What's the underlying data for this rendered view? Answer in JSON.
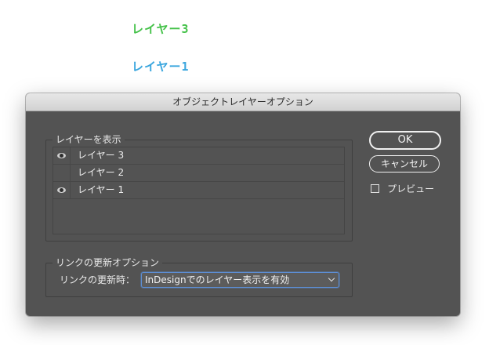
{
  "canvas": {
    "label_green": "レイヤー3",
    "label_blue": "レイヤー1"
  },
  "colors": {
    "label_green": "#45c24a",
    "label_blue": "#3aa6de",
    "dialog_bg": "#535353",
    "select_focus": "#5d8fd6"
  },
  "dialog": {
    "title": "オブジェクトレイヤーオプション",
    "layers_group": {
      "title": "レイヤーを表示",
      "layers": [
        {
          "name": "レイヤー 3",
          "visible": true,
          "visible_icon": "eye-icon"
        },
        {
          "name": "レイヤー 2",
          "visible": false
        },
        {
          "name": "レイヤー 1",
          "visible": true,
          "visible_icon": "eye-icon"
        }
      ]
    },
    "link_group": {
      "title": "リンクの更新オプション",
      "label": "リンクの更新時：",
      "selected": "InDesignでのレイヤー表示を有効"
    },
    "buttons": {
      "ok": "OK",
      "cancel": "キャンセル"
    },
    "preview": {
      "label": "プレビュー",
      "checked": false
    }
  }
}
